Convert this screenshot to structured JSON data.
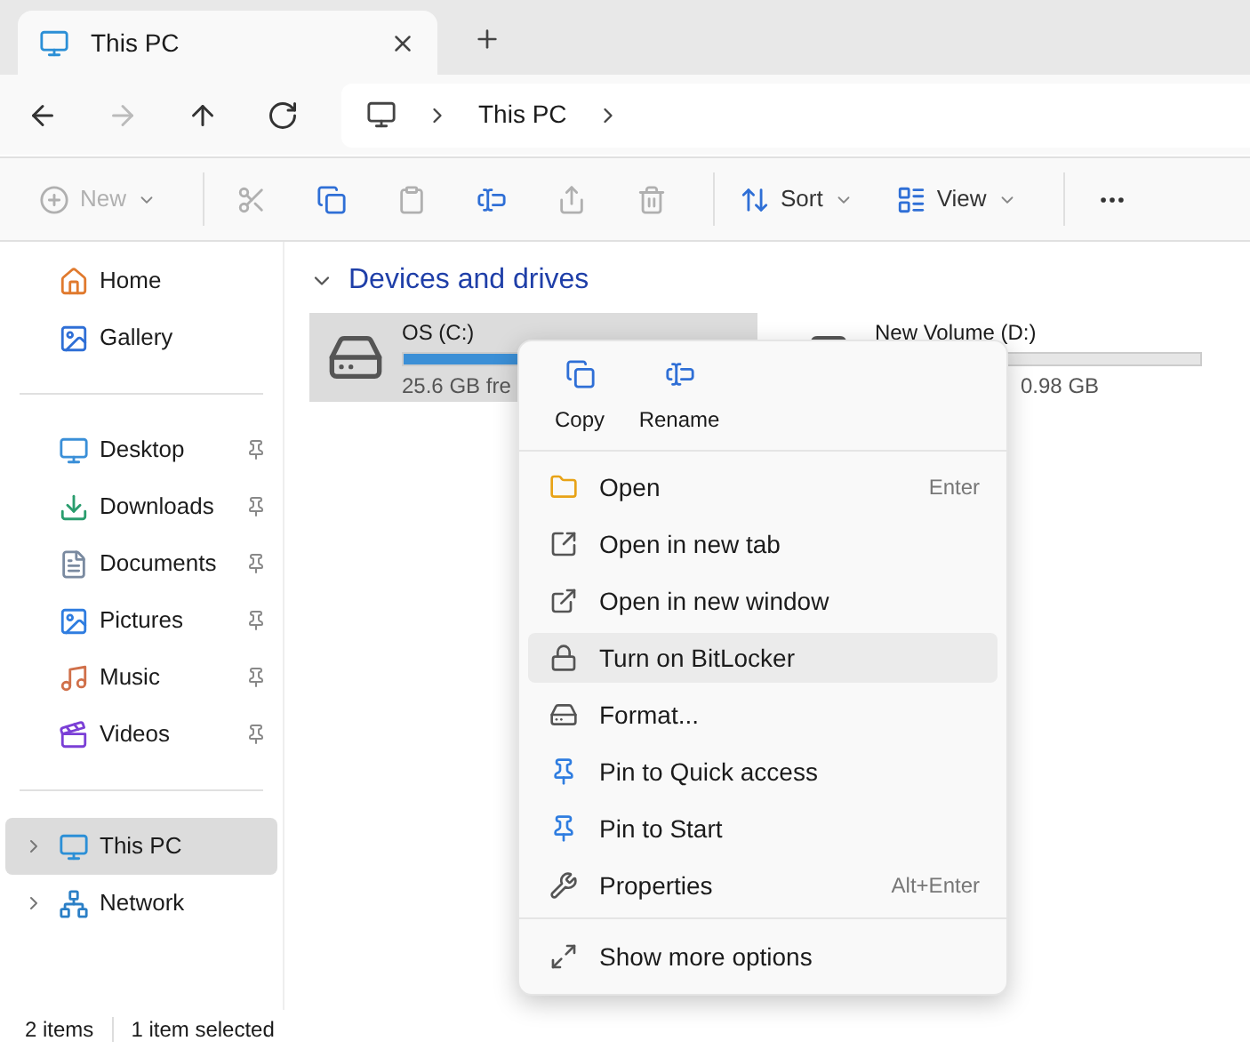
{
  "tabs": [
    {
      "title": "This PC",
      "selected": true
    }
  ],
  "nav_buttons": [
    {
      "disabled": false
    },
    {
      "disabled": true
    },
    {
      "disabled": false
    },
    {
      "disabled": false
    }
  ],
  "address": {
    "segments": [
      "This PC"
    ]
  },
  "toolbar": [
    {
      "label": "New",
      "disabled": true
    },
    {
      "disabled": true
    },
    {
      "disabled": false
    },
    {
      "disabled": true
    },
    {
      "disabled": false
    },
    {
      "disabled": true
    },
    {
      "disabled": true
    },
    {
      "label": "Sort",
      "disabled": false
    },
    {
      "label": "View",
      "disabled": false
    },
    {
      "disabled": false
    }
  ],
  "sidebar": {
    "sections": [
      {
        "items": [
          {
            "label": "Home",
            "pinned": false,
            "selected": false
          },
          {
            "label": "Gallery",
            "pinned": false,
            "selected": false
          }
        ]
      },
      {
        "items": [
          {
            "label": "Desktop",
            "pinned": true,
            "selected": false
          },
          {
            "label": "Downloads",
            "pinned": true,
            "selected": false
          },
          {
            "label": "Documents",
            "pinned": true,
            "selected": false
          },
          {
            "label": "Pictures",
            "pinned": true,
            "selected": false
          },
          {
            "label": "Music",
            "pinned": true,
            "selected": false
          },
          {
            "label": "Videos",
            "pinned": true,
            "selected": false
          }
        ]
      },
      {
        "items": [
          {
            "label": "This PC",
            "pinned": false,
            "selected": true,
            "expandable": true
          },
          {
            "label": "Network",
            "pinned": false,
            "selected": false,
            "expandable": true
          }
        ]
      }
    ]
  },
  "group": {
    "title": "Devices and drives",
    "expanded": true
  },
  "drives": [
    {
      "name": "OS (C:)",
      "level": 0.47,
      "free": "25.6 GB fre",
      "selected": true
    },
    {
      "name": "New Volume (D:)",
      "level": 0.02,
      "free": "0.98 GB",
      "selected": false
    }
  ],
  "context_menu": {
    "quick_actions": [
      "Copy",
      "Rename"
    ],
    "items": [
      {
        "label": "Open",
        "shortcut": "Enter",
        "selected": false
      },
      {
        "label": "Open in new tab",
        "selected": false
      },
      {
        "label": "Open in new window",
        "selected": false
      },
      {
        "label": "Turn on BitLocker",
        "selected": true
      },
      {
        "label": "Format...",
        "selected": false
      },
      {
        "label": "Pin to Quick access",
        "selected": false
      },
      {
        "label": "Pin to Start",
        "selected": false
      },
      {
        "label": "Properties",
        "shortcut": "Alt+Enter",
        "selected": false
      }
    ],
    "footer_item": "Show more options"
  },
  "status_bar": [
    "2 items",
    "1 item selected"
  ]
}
